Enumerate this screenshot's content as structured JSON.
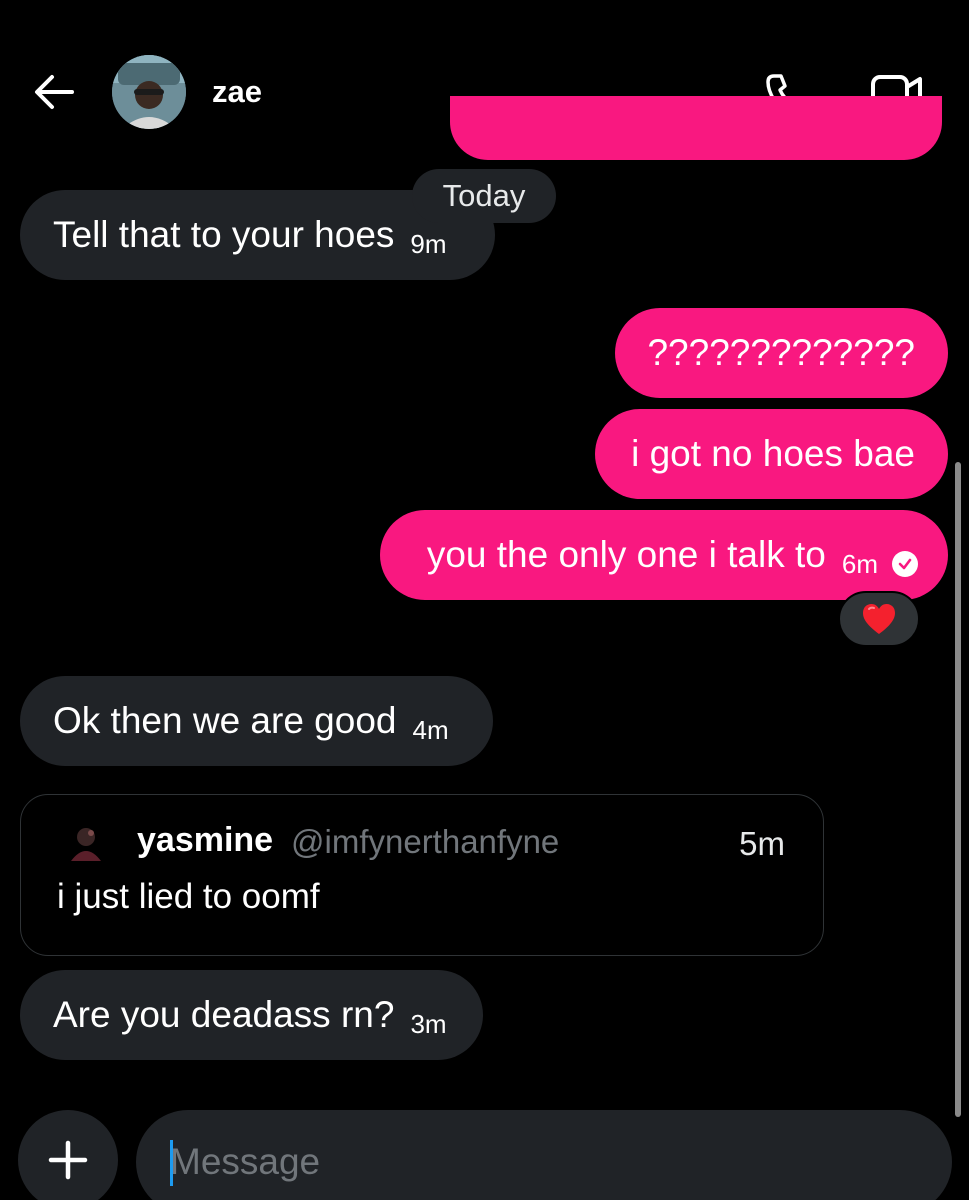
{
  "header": {
    "back_icon": "arrow-left-icon",
    "contact_name": "zae",
    "phone_icon": "phone-icon",
    "video_icon": "video-camera-icon"
  },
  "divider": {
    "today": "Today"
  },
  "messages": [
    {
      "direction": "incoming",
      "text": "Tell that to your hoes",
      "time": "9m"
    },
    {
      "direction": "outgoing",
      "text": "?????????????"
    },
    {
      "direction": "outgoing",
      "text": "i got no hoes bae"
    },
    {
      "direction": "outgoing",
      "text": "you the only one i talk to",
      "time": "6m",
      "status": "sent-check",
      "reaction": "❤️"
    },
    {
      "direction": "incoming",
      "text": "Ok then we are good",
      "time": "4m"
    },
    {
      "direction": "incoming",
      "type": "shared-post",
      "author_name": "yasmine",
      "author_handle": "@imfynerthanfyne",
      "time": "5m",
      "text": "i just lied to oomf"
    },
    {
      "direction": "incoming",
      "text": "Are you deadass rn?",
      "time": "3m"
    }
  ],
  "composer": {
    "add_icon": "plus-icon",
    "placeholder": "Message"
  },
  "colors": {
    "background": "#000000",
    "outgoing_bubble": "#f91880",
    "incoming_bubble": "#202327",
    "muted_text": "#71767b",
    "caret": "#1d9bf0"
  }
}
